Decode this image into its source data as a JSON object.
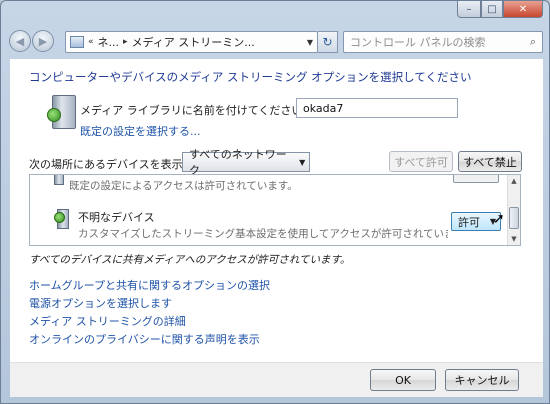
{
  "window": {
    "caption": {
      "minimize": "–",
      "maximize": "□",
      "close": "✕"
    }
  },
  "toolbar": {
    "back_glyph": "◀",
    "forward_glyph": "▶",
    "breadcrumb": [
      "«",
      "ネ...",
      "▸",
      "メディア ストリーミン..."
    ],
    "address_icon": "control-panel-icon",
    "refresh_glyph": "↻",
    "search_placeholder": "コントロール パネルの検索",
    "search_glyph": "⌕"
  },
  "main": {
    "heading": "コンピューターやデバイスのメディア ストリーミング オプションを選択してください",
    "library_name_label": "メディア ライブラリに名前を付けてください:",
    "library_name_value": "okada7",
    "default_settings_link": "既定の設定を選択する...",
    "show_devices_label": "次の場所にあるデバイスを表示:",
    "network_select": "すべてのネットワーク",
    "allow_all": "すべて許可",
    "block_all": "すべて禁止"
  },
  "devices": [
    {
      "name": "",
      "description": "既定の設定によるアクセスは許可されています。"
    },
    {
      "name": "不明なデバイス",
      "description": "カスタマイズしたストリーミング基本設定を使用してアクセスが許可されていま...",
      "permission": "許可"
    }
  ],
  "status": "すべてのデバイスに共有メディアへのアクセスが許可されています。",
  "links": [
    "ホームグループと共有に関するオプションの選択",
    "電源オプションを選択します",
    "メディア ストリーミングの詳細",
    "オンラインのプライバシーに関する声明を表示"
  ],
  "footer": {
    "ok": "OK",
    "cancel": "キャンセル"
  }
}
